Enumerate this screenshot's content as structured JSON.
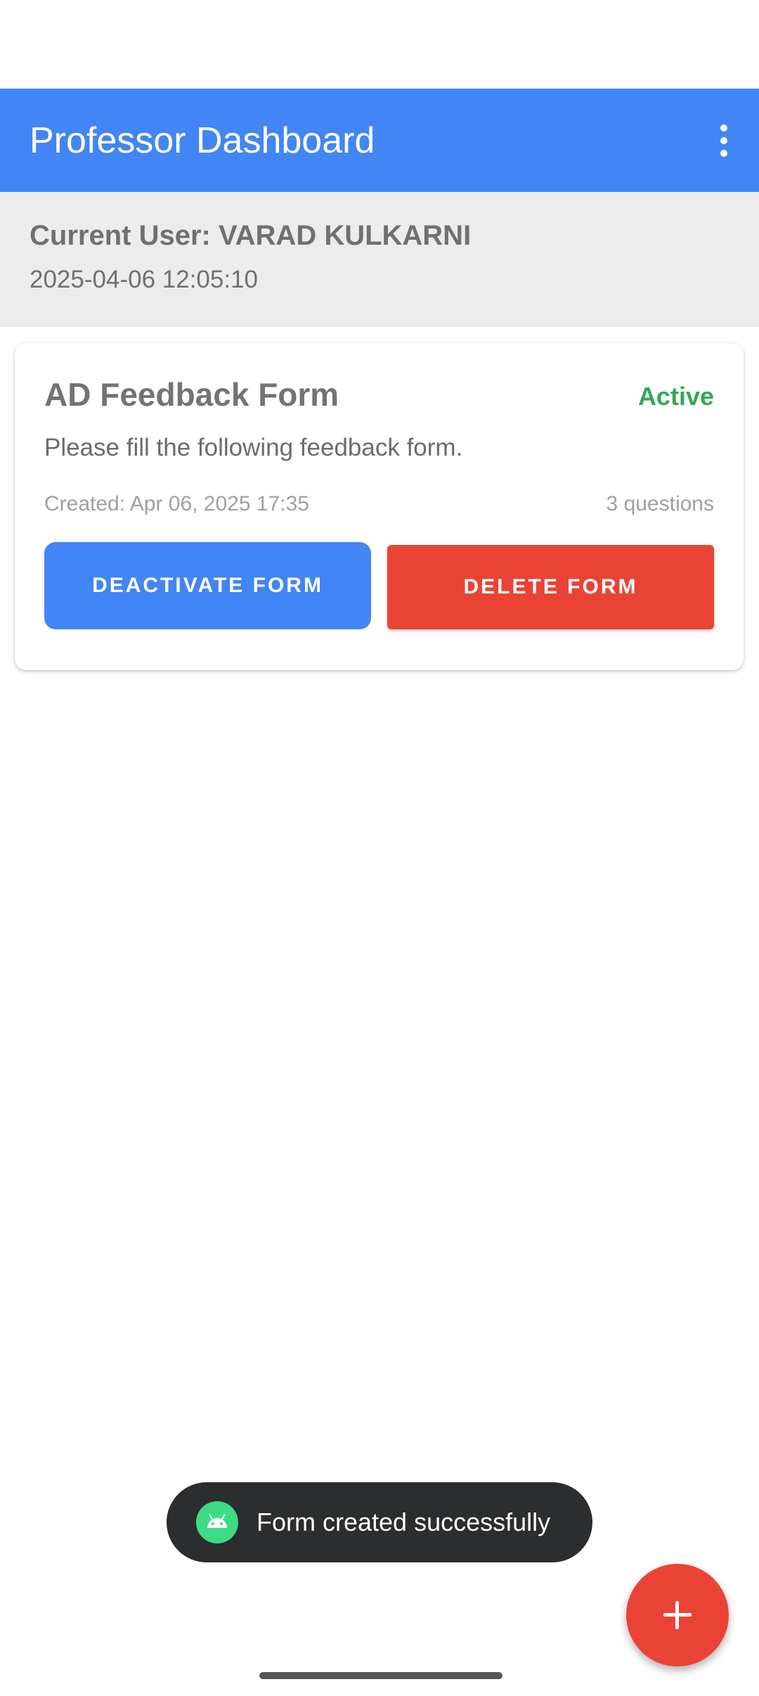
{
  "app_bar": {
    "title": "Professor Dashboard",
    "overflow_icon": "more-vert-icon",
    "background_color": "#4285f4"
  },
  "user_panel": {
    "current_user": "Current User: VARAD KULKARNI",
    "datetime": "2025-04-06 12:05:10"
  },
  "forms": [
    {
      "title": "AD Feedback Form",
      "status": "Active",
      "status_color": "#34a853",
      "description": "Please fill the following feedback form.",
      "created": "Created: Apr 06, 2025 17:35",
      "question_count": "3 questions",
      "deactivate_label": "DEACTIVATE FORM",
      "delete_label": "DELETE FORM"
    }
  ],
  "toast": {
    "icon": "android-icon",
    "message": "Form created successfully"
  },
  "fab": {
    "icon": "plus-icon",
    "color": "#ea4335"
  },
  "colors": {
    "primary": "#4285f4",
    "danger": "#ea4335",
    "success": "#34a853"
  }
}
